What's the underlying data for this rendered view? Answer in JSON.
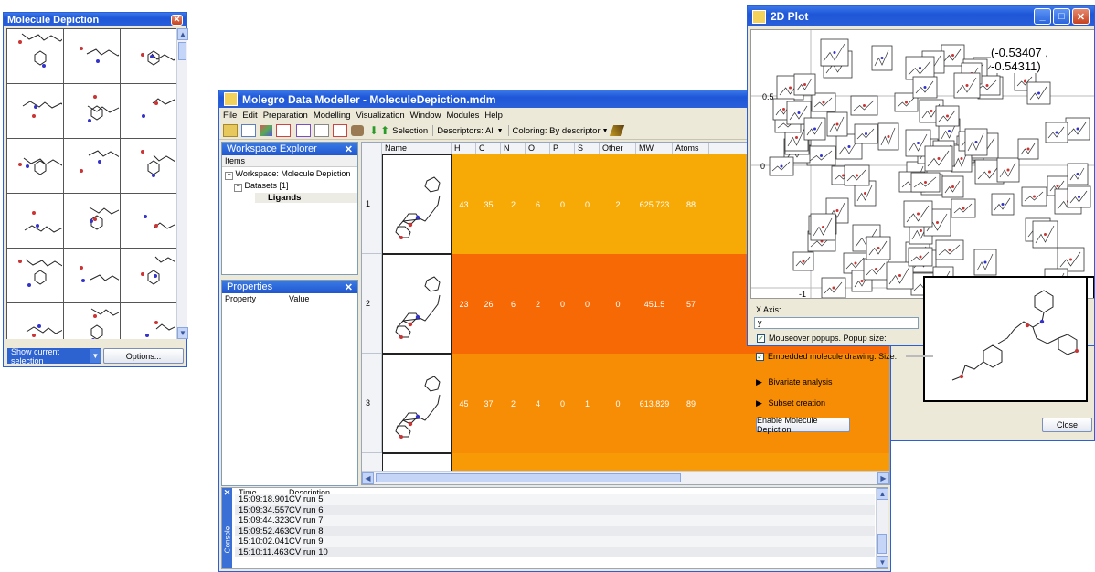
{
  "depiction_window": {
    "title": "Molecule Depiction",
    "show_selection_label": "Show current selection",
    "options_label": "Options..."
  },
  "main_window": {
    "title": "Molegro Data Modeller - MoleculeDepiction.mdm",
    "menu": [
      "File",
      "Edit",
      "Preparation",
      "Modelling",
      "Visualization",
      "Window",
      "Modules",
      "Help"
    ],
    "toolbar": {
      "selection_label": "Selection",
      "descriptors_label": "Descriptors: All",
      "coloring_label": "Coloring: By descriptor"
    },
    "workspace_explorer": {
      "title": "Workspace Explorer",
      "items_header": "Items",
      "workspace": "Workspace: Molecule Depiction",
      "datasets": "Datasets [1]",
      "ligands": "Ligands"
    },
    "properties": {
      "title": "Properties",
      "col_property": "Property",
      "col_value": "Value"
    },
    "table": {
      "columns": [
        "Name",
        "H",
        "C",
        "N",
        "O",
        "P",
        "S",
        "Other",
        "MW",
        "Atoms"
      ],
      "rows": [
        {
          "index": "1",
          "values": [
            "43",
            "35",
            "2",
            "6",
            "0",
            "0",
            "2",
            "625.723",
            "88"
          ],
          "color": "#f7aa05"
        },
        {
          "index": "2",
          "values": [
            "23",
            "26",
            "6",
            "2",
            "0",
            "0",
            "0",
            "451.5",
            "57"
          ],
          "color": "#f76905"
        },
        {
          "index": "3",
          "values": [
            "45",
            "37",
            "2",
            "4",
            "0",
            "1",
            "0",
            "613.829",
            "89"
          ],
          "color": "#f78c05"
        }
      ]
    },
    "console": {
      "label": "Console",
      "col_time": "Time",
      "col_desc": "Description",
      "entries": [
        {
          "time": "15:09:18.901",
          "desc": "CV run 5"
        },
        {
          "time": "15:09:34.557",
          "desc": "CV run 6"
        },
        {
          "time": "15:09:44.323",
          "desc": "CV run 7"
        },
        {
          "time": "15:09:52.463",
          "desc": "CV run 8"
        },
        {
          "time": "15:10:02.041",
          "desc": "CV run 9"
        },
        {
          "time": "15:10:11.463",
          "desc": "CV run 10"
        }
      ]
    }
  },
  "plot_window": {
    "title": "2D Plot",
    "coordinate_readout": "(-0.53407 , -0.54311)",
    "tick_05": "0.5",
    "tick_0": "0",
    "tick_m1": "-1",
    "x_axis_label": "X Axis:",
    "x_axis_value": "y",
    "mouseover_label": "Mouseover popups. Popup size:",
    "embedded_label": "Embedded molecule drawing. Size:",
    "bivariate_label": "Bivariate analysis",
    "subset_label": "Subset creation",
    "enable_label": "Enable Molecule Depiction",
    "close_label": "Close"
  }
}
